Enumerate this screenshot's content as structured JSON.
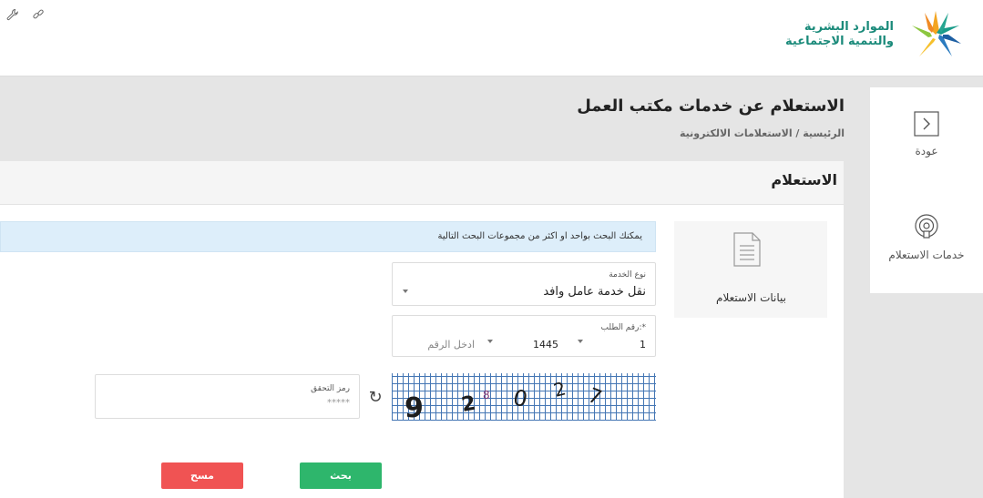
{
  "header": {
    "logo_line1": "الموارد البشرية",
    "logo_line2": "والتنمية الاجتماعية",
    "tool_icons": [
      "wrench-icon",
      "link-icon"
    ]
  },
  "page": {
    "title": "الاستعلام عن خدمات مكتب العمل",
    "breadcrumb": "الرئيسية / الاستعلامات الالكترونية"
  },
  "side_menu": {
    "back_label": "عودة",
    "services_label": "خدمات الاستعلام"
  },
  "card": {
    "title": "الاستعلام",
    "tab_label": "بيانات الاستعلام",
    "alert": "يمكنك البحث بواحد او اكثر من مجموعات البحث التالية"
  },
  "form": {
    "service_type_label": "نوع الخدمة",
    "service_type_value": "نقل خدمة عامل وافد",
    "request_number_label": "رقم الطلب:*",
    "request_part1": "1",
    "request_part2": "1445",
    "request_number_placeholder": "ادخل الرقم",
    "captcha_label": "رمز التحقق",
    "captcha_placeholder": "*****",
    "captcha_text": "92027"
  },
  "buttons": {
    "search": "بحث",
    "clear": "مسح"
  },
  "colors": {
    "search_button": "#2eb66c",
    "clear_button": "#f05353",
    "alert_background": "#ddeefa",
    "brand_teal": "#1a8a7a"
  }
}
